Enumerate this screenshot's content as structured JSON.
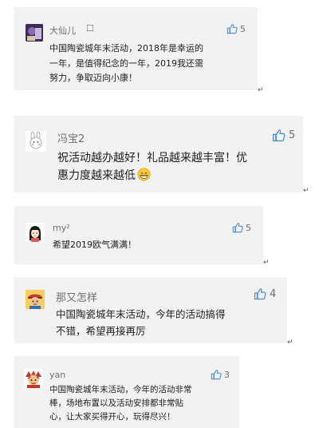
{
  "comments": [
    {
      "name": "大仙儿",
      "likes": "5",
      "text": "中国陶瓷城年末活动，2018年是幸运的\n一年，是值得纪念的一年，2019我还需\n努力，争取迈向小康！"
    },
    {
      "name": "冯宝2",
      "likes": "5",
      "text": "祝活动越办越好！礼品越来越丰富！优\n惠力度越来越低"
    },
    {
      "name": "my²",
      "likes": "5",
      "text": "希望2019欧气满满！"
    },
    {
      "name": "那又怎样",
      "likes": "4",
      "text": "中国陶瓷城年末活动，今年的活动搞得\n不错，希望再接再厉"
    },
    {
      "name": "yan",
      "likes": "3",
      "text": "中国陶瓷城年末活动，今年的活动非常\n棒，场地布置以及活动安排都非常贴\n心，让大家买得开心，玩得尽兴！"
    }
  ],
  "colors": {
    "card_bg": "#f2f2f2",
    "name_text": "#6f6f6f",
    "body_text": "#222222"
  },
  "icons": [
    "thumbs-up-icon",
    "return-mark-icon",
    "grin-emoji-icon",
    "box-glyph-icon"
  ]
}
